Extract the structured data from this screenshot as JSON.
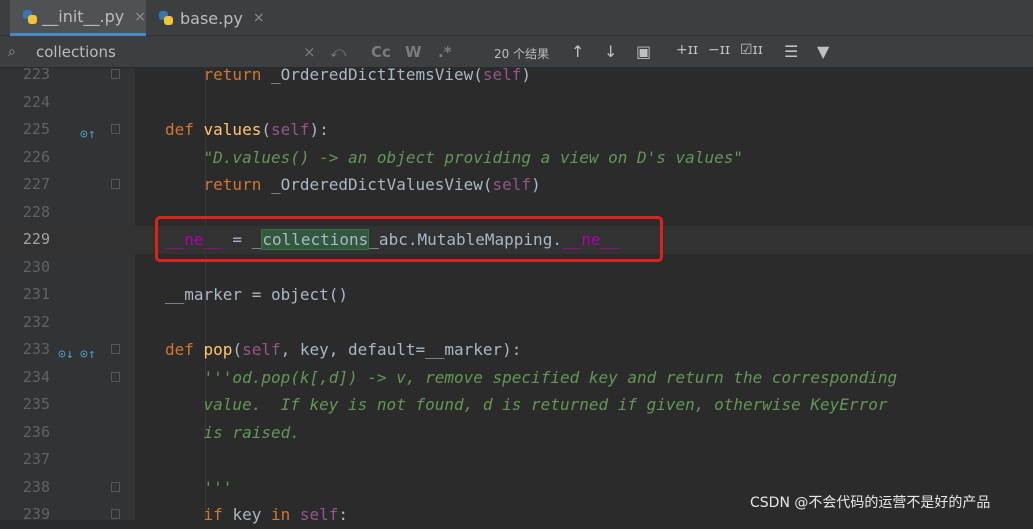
{
  "tabs": [
    {
      "label": "__init__.py",
      "close": "×",
      "active": true
    },
    {
      "label": "base.py",
      "close": "×",
      "active": false
    }
  ],
  "search": {
    "query": "collections",
    "clear": "×",
    "replace": "⤺",
    "match_case": "Cc",
    "words": "W",
    "regex": ".*",
    "results": "20 个结果"
  },
  "toolbar": {
    "prev": "↑",
    "next": "↓",
    "select_all": "▣",
    "add_occurrence": "+ɪɪ",
    "remove_occurrence": "−ɪɪ",
    "select_all_occ": "☑ɪɪ",
    "filter_opts": "☰",
    "filter": "▼"
  },
  "lines": [
    {
      "num": "223",
      "tokens": [
        {
          "t": "    return ",
          "c": "kw"
        },
        {
          "t": "_OrderedDictItemsView(",
          "c": ""
        },
        {
          "t": "self",
          "c": "slf"
        },
        {
          "t": ")",
          "c": ""
        }
      ]
    },
    {
      "num": "224",
      "tokens": []
    },
    {
      "num": "225",
      "tokens": [
        {
          "t": "def ",
          "c": "kw"
        },
        {
          "t": "values",
          "c": "fn"
        },
        {
          "t": "(",
          "c": ""
        },
        {
          "t": "self",
          "c": "slf"
        },
        {
          "t": "):",
          "c": ""
        }
      ]
    },
    {
      "num": "226",
      "tokens": [
        {
          "t": "    \"D.values() -> an object providing a view on D's values\"",
          "c": "doc"
        }
      ]
    },
    {
      "num": "227",
      "tokens": [
        {
          "t": "    return ",
          "c": "kw"
        },
        {
          "t": "_OrderedDictValuesView(",
          "c": ""
        },
        {
          "t": "self",
          "c": "slf"
        },
        {
          "t": ")",
          "c": ""
        }
      ]
    },
    {
      "num": "228",
      "tokens": []
    },
    {
      "num": "229",
      "tokens": [
        {
          "t": "__ne__",
          "c": "dund"
        },
        {
          "t": " = _",
          "c": ""
        },
        {
          "t": "collections",
          "c": "hl"
        },
        {
          "t": "_abc.MutableMapping.",
          "c": ""
        },
        {
          "t": "__ne__",
          "c": "dund"
        }
      ]
    },
    {
      "num": "230",
      "tokens": []
    },
    {
      "num": "231",
      "tokens": [
        {
          "t": "__marker = object()",
          "c": ""
        }
      ]
    },
    {
      "num": "232",
      "tokens": []
    },
    {
      "num": "233",
      "tokens": [
        {
          "t": "def ",
          "c": "kw"
        },
        {
          "t": "pop",
          "c": "fn"
        },
        {
          "t": "(",
          "c": ""
        },
        {
          "t": "self",
          "c": "slf"
        },
        {
          "t": ", key, default=__marker):",
          "c": ""
        }
      ]
    },
    {
      "num": "234",
      "tokens": [
        {
          "t": "    '''od.pop(k[,d]) -> v, remove specified key and return the corresponding",
          "c": "doc"
        }
      ]
    },
    {
      "num": "235",
      "tokens": [
        {
          "t": "    value.  If key is not found, d is returned if given, otherwise KeyError",
          "c": "doc"
        }
      ]
    },
    {
      "num": "236",
      "tokens": [
        {
          "t": "    is raised.",
          "c": "doc"
        }
      ]
    },
    {
      "num": "237",
      "tokens": []
    },
    {
      "num": "238",
      "tokens": [
        {
          "t": "    '''",
          "c": "doc"
        }
      ]
    },
    {
      "num": "239",
      "tokens": [
        {
          "t": "    if ",
          "c": "kw"
        },
        {
          "t": "key ",
          "c": ""
        },
        {
          "t": "in ",
          "c": "kw"
        },
        {
          "t": "self",
          "c": "slf"
        },
        {
          "t": ":",
          "c": ""
        }
      ]
    }
  ],
  "watermark": "CSDN @不会代码的运营不是好的产品"
}
